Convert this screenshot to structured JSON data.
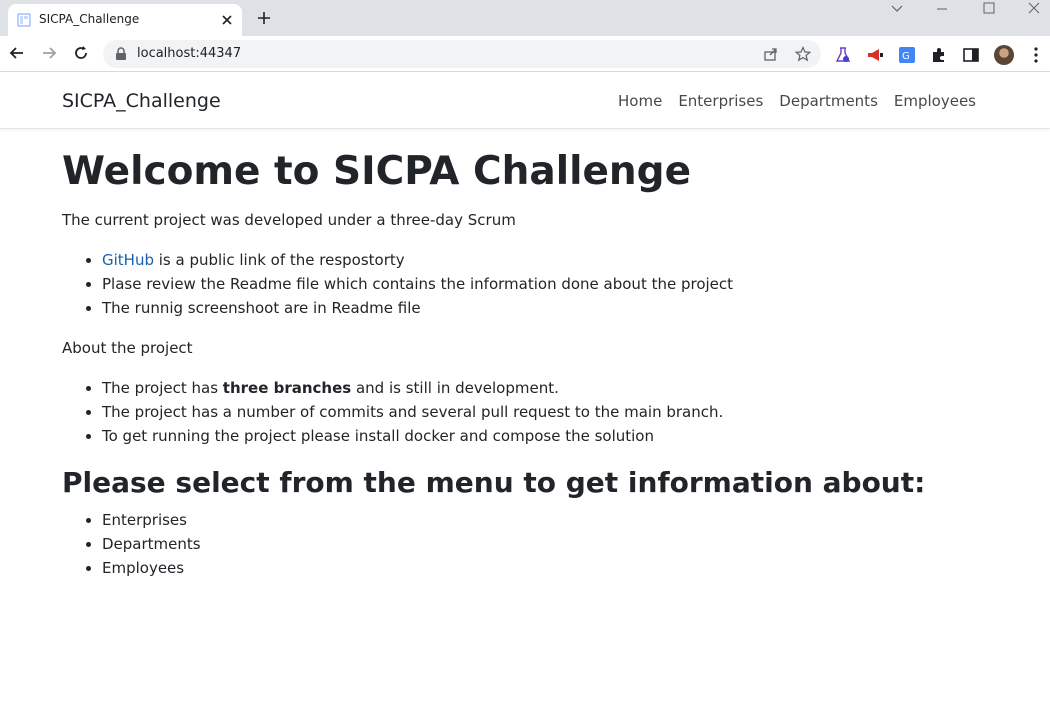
{
  "browser": {
    "tab_title": "SICPA_Challenge",
    "url": "localhost:44347"
  },
  "navbar": {
    "brand": "SICPA_Challenge",
    "links": [
      "Home",
      "Enterprises",
      "Departments",
      "Employees"
    ]
  },
  "main": {
    "heading": "Welcome to SICPA Challenge",
    "intro": "The current project was developed under a three-day Scrum",
    "links_list": {
      "github_link": "GitHub",
      "github_rest": " is a public link of the respostorty",
      "item2": "Plase review the Readme file which contains the information done about the project",
      "item3": "The runnig screenshoot are in Readme file"
    },
    "about": "About the project",
    "about_list": {
      "item1_pre": "The project has ",
      "item1_bold": "three branches",
      "item1_post": " and is still in development.",
      "item2": "The project has a number of commits and several pull request to the main branch.",
      "item3": "To get running the project please install docker and compose the solution"
    },
    "subheading": "Please select from the menu to get information about:",
    "menu_list": [
      "Enterprises",
      "Departments",
      "Employees"
    ]
  },
  "colors": {
    "link": "#1861ac",
    "tabstrip": "#dee1e6"
  }
}
